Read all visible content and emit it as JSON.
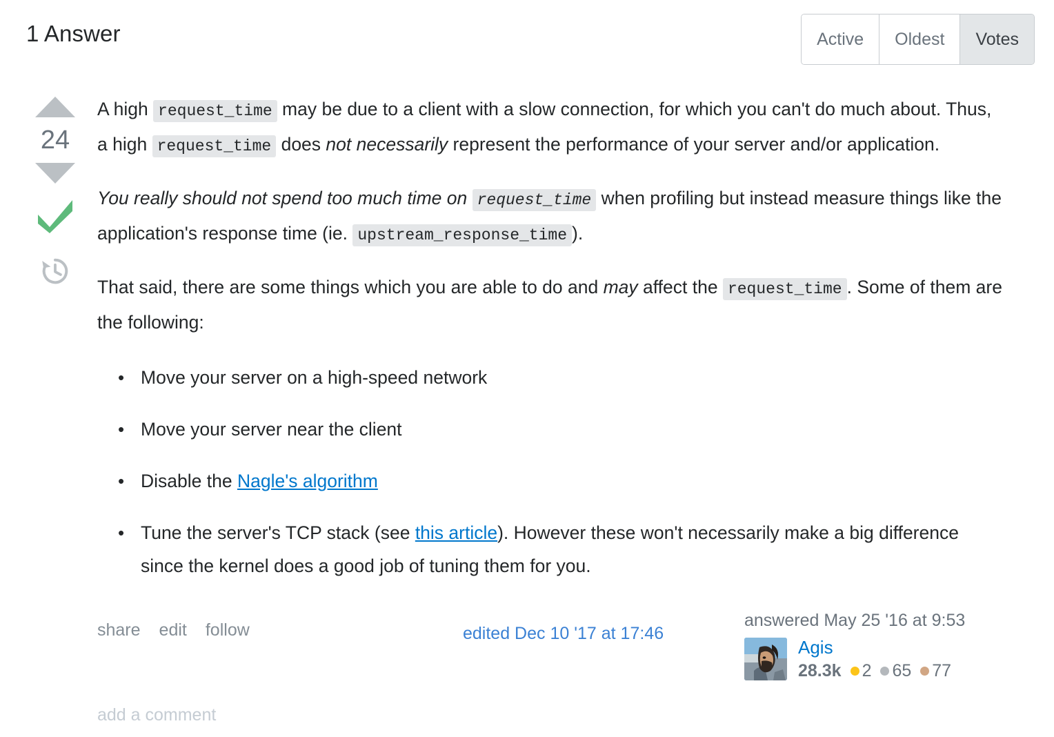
{
  "header": {
    "answers_title": "1 Answer",
    "sort_tabs": [
      {
        "label": "Active",
        "selected": false
      },
      {
        "label": "Oldest",
        "selected": false
      },
      {
        "label": "Votes",
        "selected": true
      }
    ]
  },
  "answer": {
    "vote": {
      "score": "24",
      "upvote_icon": "arrow-up-icon",
      "downvote_icon": "arrow-down-icon",
      "accepted_icon": "checkmark-icon",
      "history_icon": "history-clock-icon"
    },
    "body": {
      "p1": {
        "t1": "A high ",
        "code1": "request_time",
        "t2": " may be due to a client with a slow connection, for which you can't do much about. Thus, a high ",
        "code2": "request_time",
        "t3": " does ",
        "em1": "not necessarily",
        "t4": " represent the performance of your server and/or application."
      },
      "p2": {
        "em1": "You really should not spend too much time on ",
        "code1": "request_time",
        "t1": " when profiling but instead measure things like the application's response time (ie. ",
        "code2": "upstream_response_time",
        "t2": ")."
      },
      "p3": {
        "t1": "That said, there are some things which you are able to do and ",
        "em1": "may",
        "t2": " affect the ",
        "code1": "request_time",
        "t3": ". Some of them are the following:"
      },
      "list": [
        {
          "t1": "Move your server on a high-speed network"
        },
        {
          "t1": "Move your server near the client"
        },
        {
          "t1": "Disable the ",
          "link": "Nagle's algorithm",
          "t2": ""
        },
        {
          "t1": "Tune the server's TCP stack (see ",
          "link": "this article",
          "t2": "). However these won't necessarily make a big difference since the kernel does a good job of tuning them for you."
        }
      ]
    },
    "footer": {
      "menu": [
        "share",
        "edit",
        "follow"
      ],
      "edited_signature": "edited Dec 10 '17 at 17:46",
      "answered_signature": "answered May 25 '16 at 9:53",
      "user": {
        "name": "Agis",
        "reputation": "28.3k",
        "gold_badges": "2",
        "silver_badges": "65",
        "bronze_badges": "77",
        "avatar_icon": "user-avatar-photo"
      }
    },
    "add_comment": "add a comment"
  },
  "colors": {
    "link": "#0077cc",
    "accent_edited": "#3b81d4",
    "accepted_green": "#5eba7b",
    "vote_arrow": "#bbc0c4",
    "code_bg": "#e4e6e8",
    "muted": "#6a737c",
    "gold": "#fcc419",
    "silver": "#b4b8bc",
    "bronze": "#d1a684"
  }
}
